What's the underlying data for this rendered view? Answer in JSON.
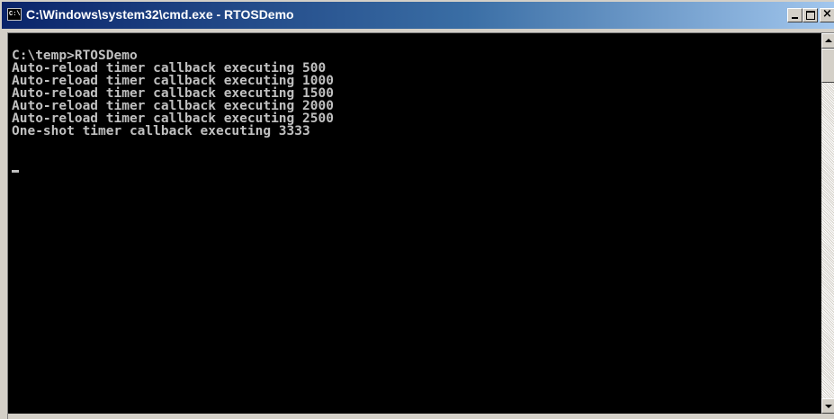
{
  "window": {
    "title": "C:\\Windows\\system32\\cmd.exe - RTOSDemo",
    "icon_label": "C:\\",
    "icon": "console-icon"
  },
  "caption_buttons": {
    "minimize_icon": "minimize-icon",
    "maximize_icon": "maximize-icon",
    "close_icon": "close-icon",
    "close_glyph": "×"
  },
  "console": {
    "lines": [
      "C:\\temp>RTOSDemo",
      "Auto-reload timer callback executing 500",
      "Auto-reload timer callback executing 1000",
      "Auto-reload timer callback executing 1500",
      "Auto-reload timer callback executing 2000",
      "Auto-reload timer callback executing 2500",
      "One-shot timer callback executing 3333"
    ],
    "text_color": "#c0c0c0",
    "background_color": "#000000"
  },
  "scrollbar": {
    "up_icon": "scroll-up-arrow-icon",
    "down_icon": "scroll-down-arrow-icon"
  },
  "colors": {
    "titlebar_start": "#0a246a",
    "titlebar_end": "#a6caf0",
    "chrome": "#d4d0c8"
  }
}
